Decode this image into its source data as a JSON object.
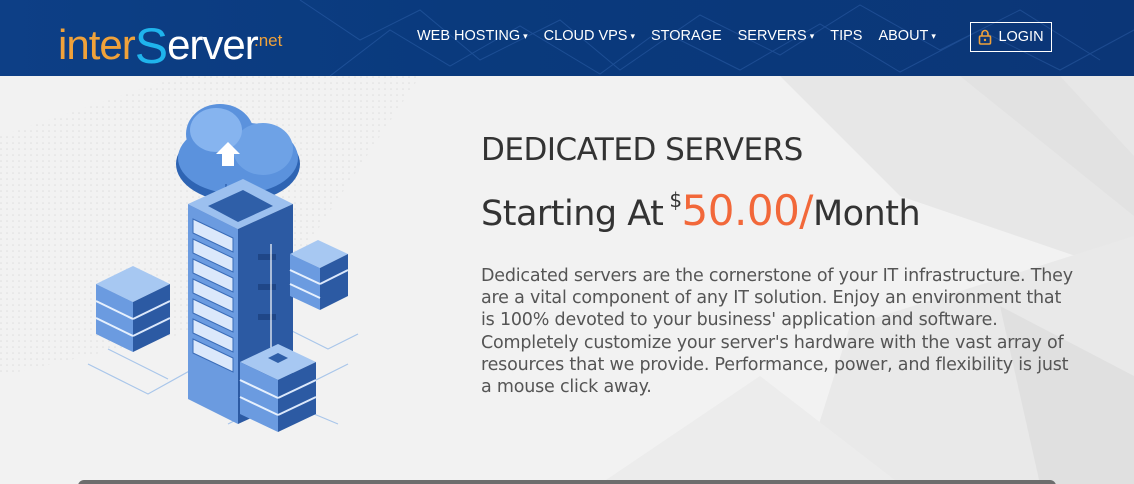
{
  "header": {
    "logo": {
      "part1": "inter",
      "part2": "S",
      "part3": "erver",
      "suffix": ".net"
    },
    "nav": [
      {
        "label": "WEB HOSTING",
        "has_dropdown": true
      },
      {
        "label": "CLOUD VPS",
        "has_dropdown": true
      },
      {
        "label": "STORAGE",
        "has_dropdown": false
      },
      {
        "label": "SERVERS",
        "has_dropdown": true
      },
      {
        "label": "TIPS",
        "has_dropdown": false
      },
      {
        "label": "ABOUT",
        "has_dropdown": true
      }
    ],
    "login_label": "LOGIN",
    "login_icon": "lock-icon"
  },
  "hero": {
    "title": "DEDICATED SERVERS",
    "price_prefix": "Starting At",
    "currency": "$",
    "price": "50.00/",
    "price_suffix": "Month",
    "description": "Dedicated servers are the cornerstone of your IT infrastructure. They are a vital component of any IT solution. Enjoy an environment that is 100% devoted to your business' application and software. Completely customize your server's hardware with the vast array of resources that we provide. Performance, power, and flexibility is just a mouse click away.",
    "illustration": "server-cloud-illustration"
  },
  "colors": {
    "header_bg": "#0d3f86",
    "accent_orange": "#f2683a",
    "logo_orange": "#f0a23a",
    "logo_blue": "#1fb4ec"
  }
}
